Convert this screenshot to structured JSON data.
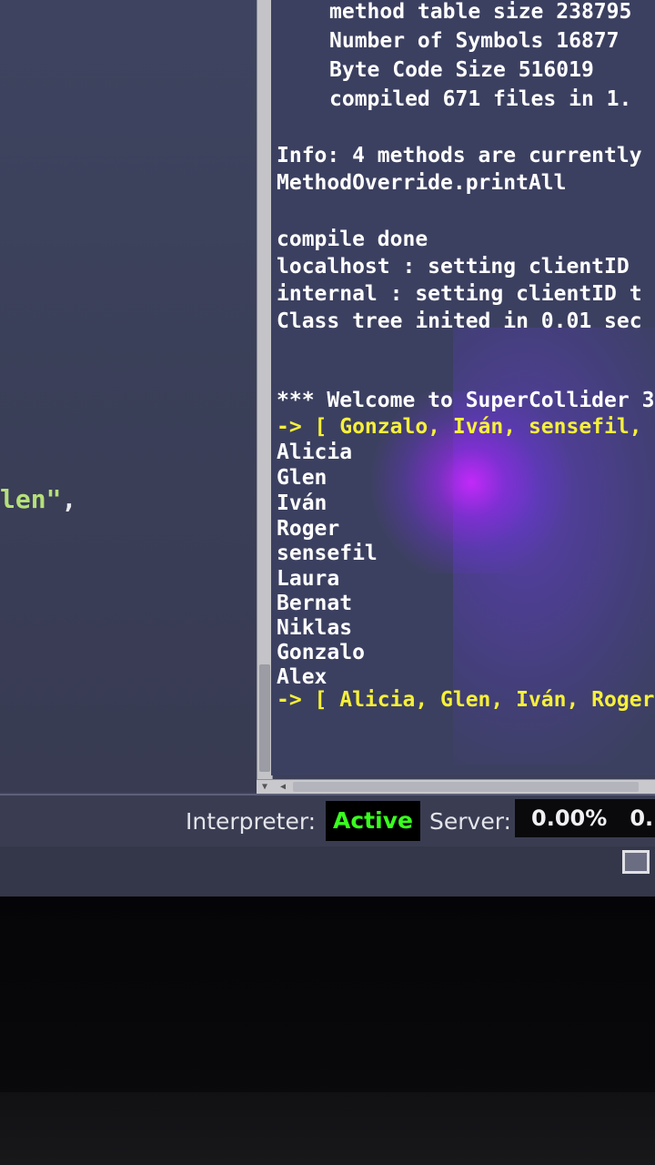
{
  "editor": {
    "fragment_string": "len\"",
    "fragment_comma": ","
  },
  "post_window": {
    "compile_info": [
      "method table size 238795",
      "Number of Symbols 16877",
      "Byte Code Size 516019",
      "compiled 671 files in 1."
    ],
    "info_line": "Info: 4 methods are currently",
    "override_line": "MethodOverride.printAll",
    "status_lines": [
      "compile done",
      "localhost : setting clientID",
      "internal : setting clientID t",
      "Class tree inited in 0.01 sec"
    ],
    "welcome": "*** Welcome to SuperCollider 3",
    "result_1": "-> [ Gonzalo, Iván, sensefil,",
    "names": [
      "Alicia",
      "Glen",
      "Iván",
      "Roger",
      "sensefil",
      "Laura",
      "Bernat",
      "Niklas",
      "Gonzalo",
      "Alex"
    ],
    "result_2": "-> [ Alicia, Glen, Iván, Roger,"
  },
  "status_bar": {
    "interpreter_label": "Interpreter:",
    "interpreter_state": "Active",
    "server_label": "Server:",
    "server_values": "0.00%   0."
  },
  "colors": {
    "active_text": "#39ff1f",
    "result_text": "#f6f03a",
    "post_bg": "#3c4060"
  }
}
